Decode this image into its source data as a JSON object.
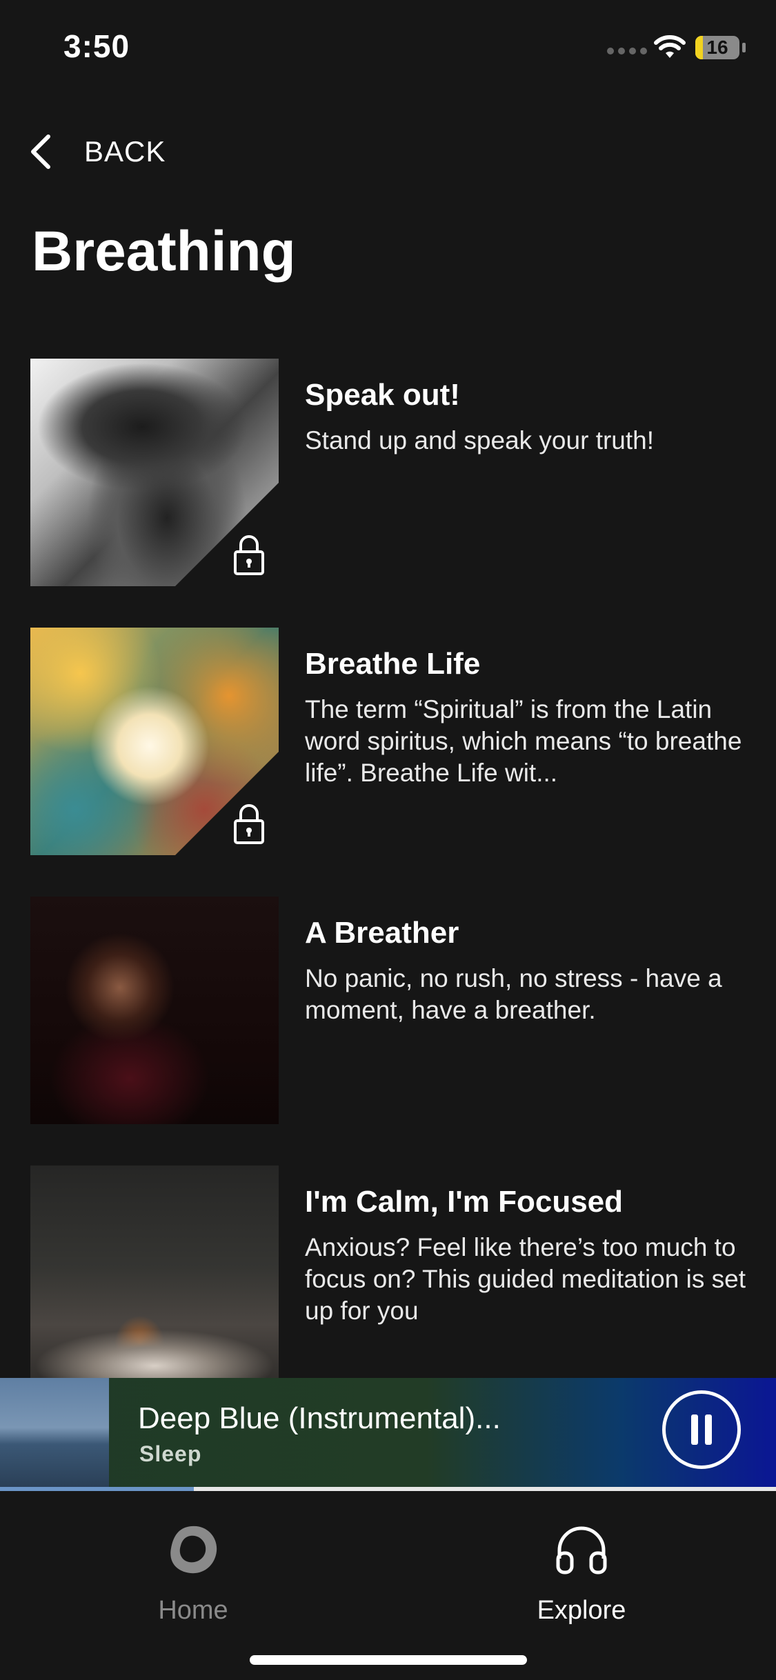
{
  "status_bar": {
    "time": "3:50",
    "battery": "16"
  },
  "nav": {
    "back_label": "BACK"
  },
  "page": {
    "title": "Breathing"
  },
  "items": [
    {
      "title": "Speak out!",
      "description": "Stand up and speak your truth!",
      "locked": true
    },
    {
      "title": "Breathe Life",
      "description": "The term “Spiritual” is from the Latin word spiritus, which means “to breathe life”. Breathe Life wit...",
      "locked": true
    },
    {
      "title": "A Breather",
      "description": "No panic, no rush, no stress - have a moment, have a breather.",
      "locked": false
    },
    {
      "title": "I'm Calm, I'm Focused",
      "description": "Anxious? Feel like there’s too much to focus on? This guided meditation is set up for you",
      "locked": false
    }
  ],
  "now_playing": {
    "title": "Deep Blue (Instrumental)...",
    "subtitle": "Sleep",
    "progress_fraction": 0.25
  },
  "tabs": [
    {
      "label": "Home",
      "icon": "home-blob-icon",
      "active": false
    },
    {
      "label": "Explore",
      "icon": "headphones-icon",
      "active": true
    }
  ],
  "colors": {
    "background": "#161616",
    "inactive_tab": "#8a8a8a",
    "active_tab": "#ffffff",
    "progress": "#6b95c7"
  }
}
